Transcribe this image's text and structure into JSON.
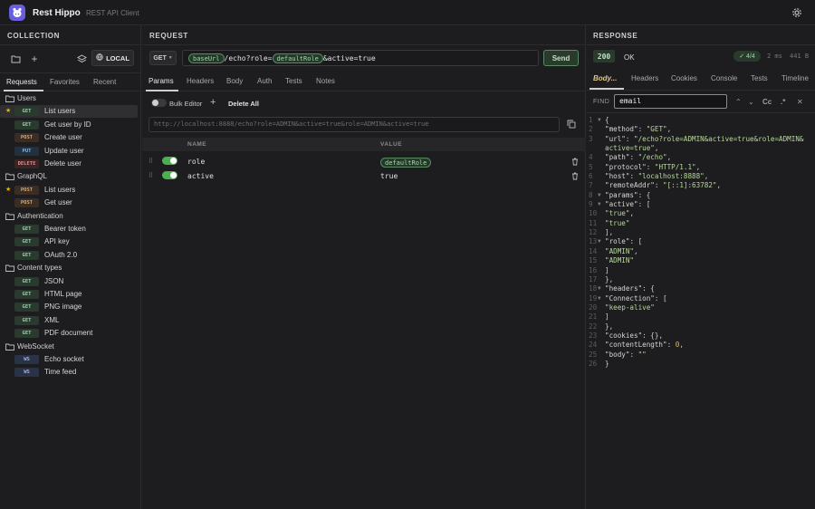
{
  "app": {
    "name": "Rest Hippo",
    "subtitle": "REST API Client"
  },
  "sidebar": {
    "title": "COLLECTION",
    "env_label": "LOCAL",
    "tabs": [
      "Requests",
      "Favorites",
      "Recent"
    ],
    "folders": [
      {
        "label": "Users",
        "items": [
          {
            "method": "GET",
            "label": "List users",
            "starred": true,
            "selected": true
          },
          {
            "method": "GET",
            "label": "Get user by ID"
          },
          {
            "method": "POST",
            "label": "Create user"
          },
          {
            "method": "PUT",
            "label": "Update user"
          },
          {
            "method": "DELETE",
            "label": "Delete user"
          }
        ]
      },
      {
        "label": "GraphQL",
        "items": [
          {
            "method": "POST",
            "label": "List users",
            "starred": true
          },
          {
            "method": "POST",
            "label": "Get user"
          }
        ]
      },
      {
        "label": "Authentication",
        "items": [
          {
            "method": "GET",
            "label": "Bearer token"
          },
          {
            "method": "GET",
            "label": "API key"
          },
          {
            "method": "GET",
            "label": "OAuth 2.0"
          }
        ]
      },
      {
        "label": "Content types",
        "items": [
          {
            "method": "GET",
            "label": "JSON"
          },
          {
            "method": "GET",
            "label": "HTML page"
          },
          {
            "method": "GET",
            "label": "PNG image"
          },
          {
            "method": "GET",
            "label": "XML"
          },
          {
            "method": "GET",
            "label": "PDF document"
          }
        ]
      },
      {
        "label": "WebSocket",
        "items": [
          {
            "method": "WS",
            "label": "Echo socket"
          },
          {
            "method": "WS",
            "label": "Time feed"
          }
        ]
      }
    ]
  },
  "request": {
    "title": "REQUEST",
    "method": "GET",
    "url": {
      "base_var": "baseUrl",
      "path": "/echo?role=",
      "role_var": "defaultRole",
      "rest": "&active=true"
    },
    "send_label": "Send",
    "tabs": [
      "Params",
      "Headers",
      "Body",
      "Auth",
      "Tests",
      "Notes"
    ],
    "bulk_editor_label": "Bulk Editor",
    "delete_all_label": "Delete All",
    "preview_url": "http://localhost:8888/echo?role=ADMIN&active=true&role=ADMIN&active=true",
    "columns": {
      "name": "NAME",
      "value": "VALUE"
    },
    "params": [
      {
        "name": "role",
        "value": "defaultRole",
        "is_var": true,
        "enabled": true
      },
      {
        "name": "active",
        "value": "true",
        "is_var": false,
        "enabled": true
      }
    ]
  },
  "response": {
    "title": "RESPONSE",
    "status_code": "200",
    "status_text": "OK",
    "tests": "✓ 4/4",
    "time": "2 ms",
    "size": "441 B",
    "tabs": [
      "Body...",
      "Headers",
      "Cookies",
      "Console",
      "Tests",
      "Timeline"
    ],
    "find_label": "FIND",
    "find_value": "email",
    "find_tools": [
      "Cc",
      ".*"
    ],
    "lines": [
      {
        "n": "1",
        "fold": true,
        "text": "{"
      },
      {
        "n": "2",
        "text": "  \"method\": \"GET\","
      },
      {
        "n": "3",
        "text": "  \"url\": \"/echo?role=ADMIN&active=true&role=ADMIN&"
      },
      {
        "n": "",
        "text": "active=true\","
      },
      {
        "n": "4",
        "text": "  \"path\": \"/echo\","
      },
      {
        "n": "5",
        "text": "  \"protocol\": \"HTTP/1.1\","
      },
      {
        "n": "6",
        "text": "  \"host\": \"localhost:8888\","
      },
      {
        "n": "7",
        "text": "  \"remoteAddr\": \"[::1]:63782\","
      },
      {
        "n": "8",
        "fold": true,
        "text": "  \"params\": {"
      },
      {
        "n": "9",
        "fold": true,
        "text": "    \"active\": ["
      },
      {
        "n": "10",
        "text": "      \"true\","
      },
      {
        "n": "11",
        "text": "      \"true\""
      },
      {
        "n": "12",
        "text": "    ],"
      },
      {
        "n": "13",
        "fold": true,
        "text": "    \"role\": ["
      },
      {
        "n": "14",
        "text": "      \"ADMIN\","
      },
      {
        "n": "15",
        "text": "      \"ADMIN\""
      },
      {
        "n": "16",
        "text": "    ]"
      },
      {
        "n": "17",
        "text": "  },"
      },
      {
        "n": "18",
        "fold": true,
        "text": "  \"headers\": {"
      },
      {
        "n": "19",
        "fold": true,
        "text": "    \"Connection\": ["
      },
      {
        "n": "20",
        "text": "      \"keep-alive\""
      },
      {
        "n": "21",
        "text": "    ]"
      },
      {
        "n": "22",
        "text": "  },"
      },
      {
        "n": "23",
        "text": "  \"cookies\": {},"
      },
      {
        "n": "24",
        "text": "  \"contentLength\": 0,"
      },
      {
        "n": "25",
        "text": "  \"body\": \"\""
      },
      {
        "n": "26",
        "text": "}"
      }
    ]
  },
  "colors": {
    "accent": "#6a5de0",
    "success": "#4caf50",
    "star": "#e6b800"
  }
}
